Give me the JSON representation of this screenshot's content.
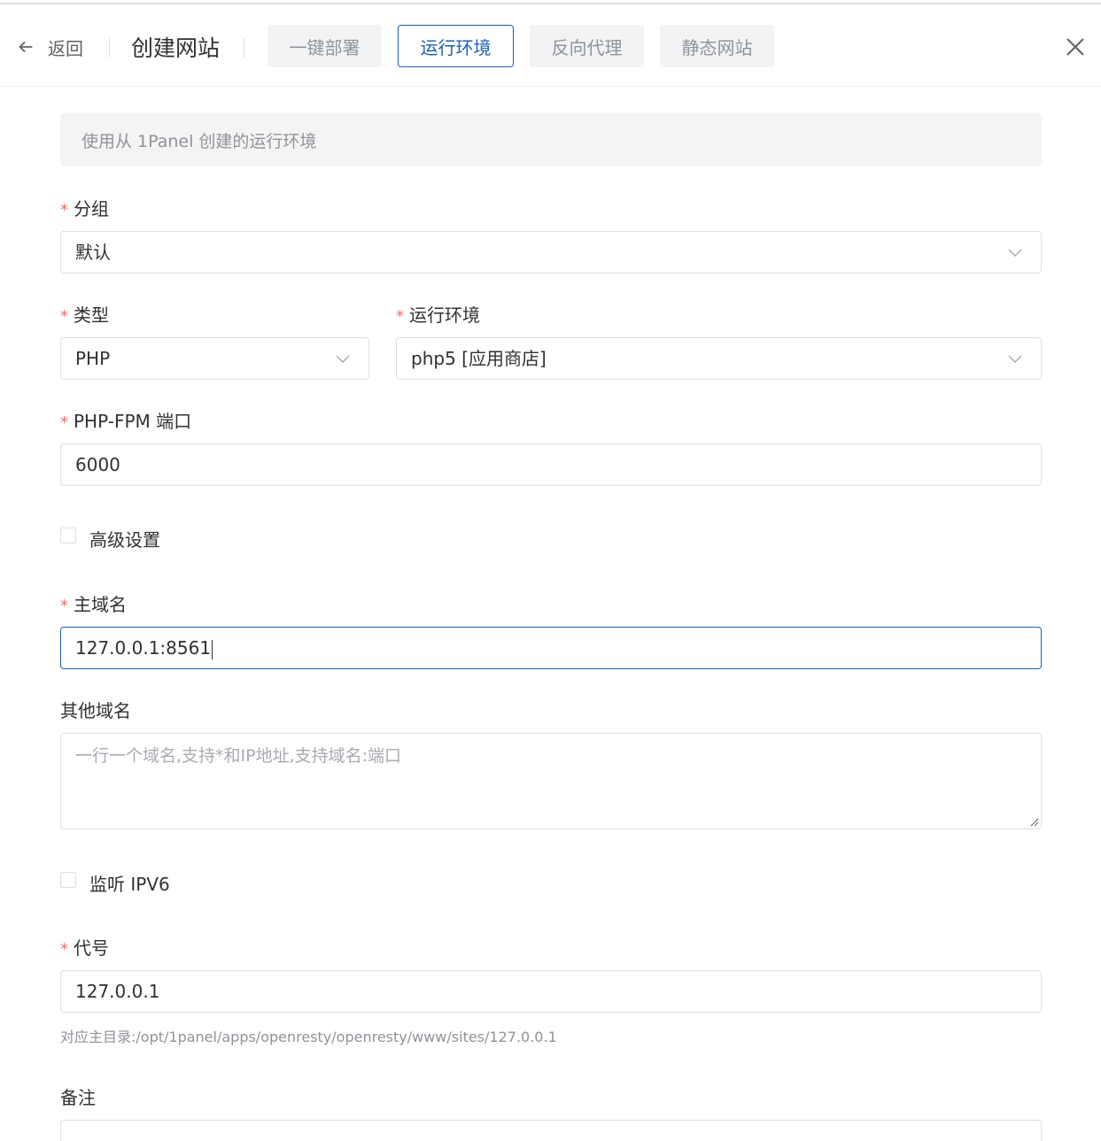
{
  "header": {
    "back_label": "返回",
    "title": "创建网站",
    "tabs": [
      {
        "label": "一键部署",
        "active": false
      },
      {
        "label": "运行环境",
        "active": true
      },
      {
        "label": "反向代理",
        "active": false
      },
      {
        "label": "静态网站",
        "active": false
      }
    ]
  },
  "notice": "使用从 1Panel 创建的运行环境",
  "form": {
    "group": {
      "label": "分组",
      "value": "默认"
    },
    "type": {
      "label": "类型",
      "value": "PHP"
    },
    "runtime": {
      "label": "运行环境",
      "value": "php5 [应用商店]"
    },
    "php_fpm_port": {
      "label": "PHP-FPM 端口",
      "value": "6000"
    },
    "advanced": {
      "label": "高级设置",
      "checked": false
    },
    "primary_domain": {
      "label": "主域名",
      "value": "127.0.0.1:8561"
    },
    "other_domains": {
      "label": "其他域名",
      "placeholder": "一行一个域名,支持*和IP地址,支持域名:端口"
    },
    "listen_ipv6": {
      "label": "监听 IPV6",
      "checked": false
    },
    "alias": {
      "label": "代号",
      "value": "127.0.0.1",
      "hint": "对应主目录:/opt/1panel/apps/openresty/openresty/www/sites/127.0.0.1"
    },
    "remark": {
      "label": "备注"
    }
  },
  "colors": {
    "accent": "#1b5fb4",
    "required": "#f56c6c",
    "placeholder": "#a8abb2"
  }
}
